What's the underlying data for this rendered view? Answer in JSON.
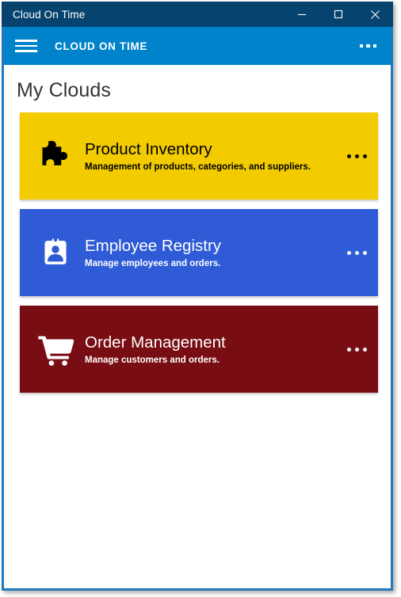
{
  "window": {
    "title": "Cloud On Time",
    "border_color": "#2179bd",
    "titlebar_color": "#06436e",
    "controls": {
      "minimize": "minimize",
      "maximize": "maximize",
      "close": "close"
    }
  },
  "appbar": {
    "menu_icon": "hamburger-icon",
    "title": "CLOUD ON TIME",
    "more_icon": "more-options-icon",
    "background": "#0083ca"
  },
  "main": {
    "page_title": "My Clouds",
    "cards": [
      {
        "title": "Product Inventory",
        "subtitle": "Management of products, categories, and suppliers.",
        "icon": "puzzle-piece-icon",
        "background": "#f2cb00",
        "foreground": "#000000",
        "more_icon": "more-options-icon"
      },
      {
        "title": "Employee Registry",
        "subtitle": "Manage employees and orders.",
        "icon": "id-badge-icon",
        "background": "#2f5bd7",
        "foreground": "#ffffff",
        "more_icon": "more-options-icon"
      },
      {
        "title": "Order Management",
        "subtitle": "Manage customers and orders.",
        "icon": "shopping-cart-icon",
        "background": "#780d14",
        "foreground": "#ffffff",
        "more_icon": "more-options-icon"
      }
    ]
  }
}
